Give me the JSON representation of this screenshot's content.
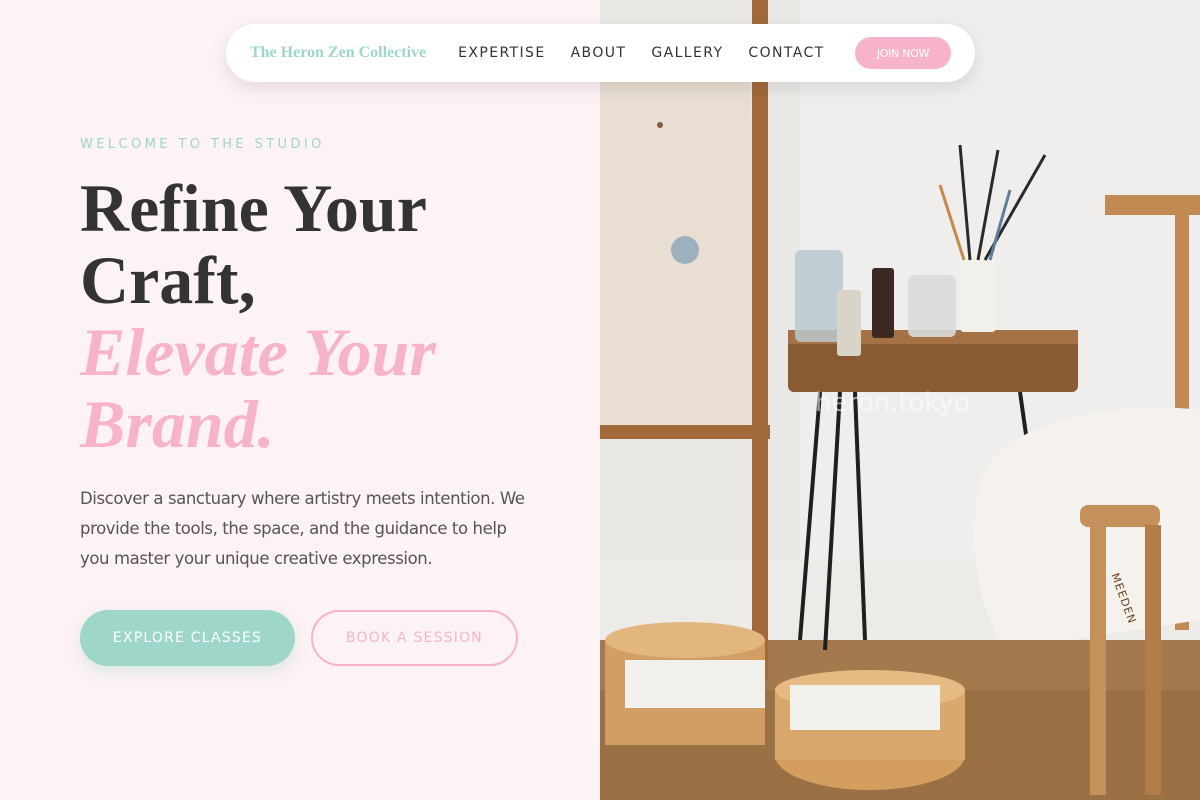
{
  "nav": {
    "brand": "The Heron Zen Collective",
    "links": [
      "EXPERTISE",
      "ABOUT",
      "GALLERY",
      "CONTACT"
    ],
    "join_label": "JOIN NOW"
  },
  "hero": {
    "eyebrow": "WELCOME TO THE STUDIO",
    "headline_line1": "Refine Your",
    "headline_line2": "Craft,",
    "headline_accent1": "Elevate Your",
    "headline_accent2": "Brand.",
    "description": "Discover a sanctuary where artistry meets intention. We provide the tools, the space, and the guidance to help you master your unique creative expression.",
    "primary_button": "EXPLORE CLASSES",
    "secondary_button": "BOOK A SESSION"
  },
  "photo": {
    "watermark": "heron.tokyo",
    "stool_text": "MEEDEN"
  },
  "colors": {
    "background": "#fdf2f4",
    "mint": "#9ed6c9",
    "pink": "#f7b4c8",
    "text": "#333333"
  }
}
